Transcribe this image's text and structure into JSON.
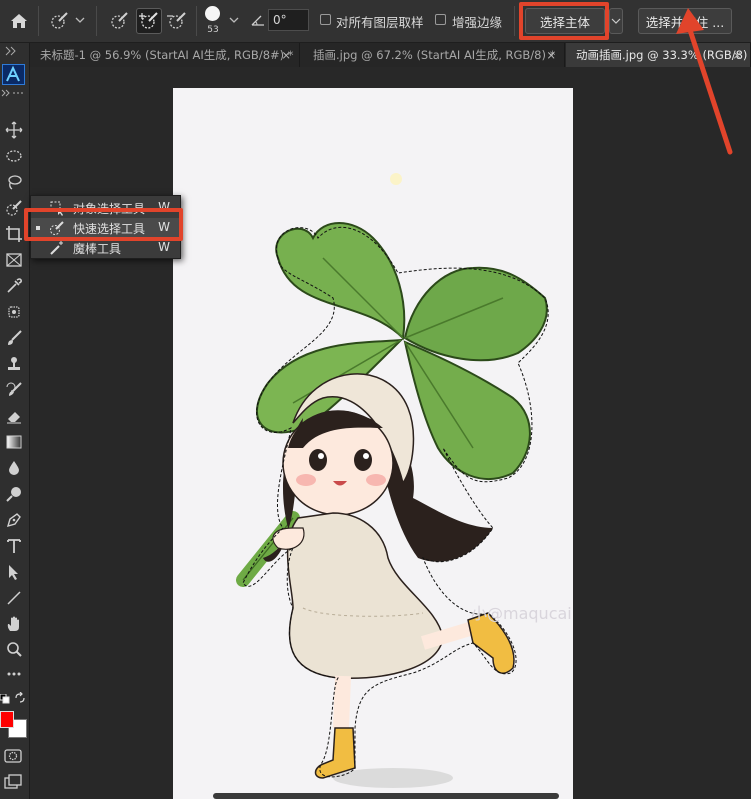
{
  "options_bar": {
    "brush_size": "53",
    "angle_value": "0°",
    "sample_all_layers_label": "对所有图层取样",
    "enhance_edge_label": "增强边缘",
    "select_subject_label": "选择主体",
    "select_and_mask_label": "选择并遮住 ..."
  },
  "tabs": [
    {
      "label": "未标题-1 @ 56.9% (StartAI AI生成, RGB/8#) *",
      "close": "×"
    },
    {
      "label": "插画.jpg @ 67.2% (StartAI AI生成, RGB/8) *",
      "close": "×"
    },
    {
      "label": "动画插画.jpg @ 33.3% (RGB/8)",
      "close": "×"
    }
  ],
  "flyout": {
    "items": [
      {
        "label": "对象选择工具",
        "key": "W"
      },
      {
        "label": "快速选择工具",
        "key": "W"
      },
      {
        "label": "魔棒工具",
        "key": "W"
      }
    ]
  },
  "canvas": {
    "watermark": "小@maqucai"
  },
  "colors": {
    "foreground": "#ff0000",
    "background": "#ffffff",
    "annotation": "#e1442b"
  }
}
